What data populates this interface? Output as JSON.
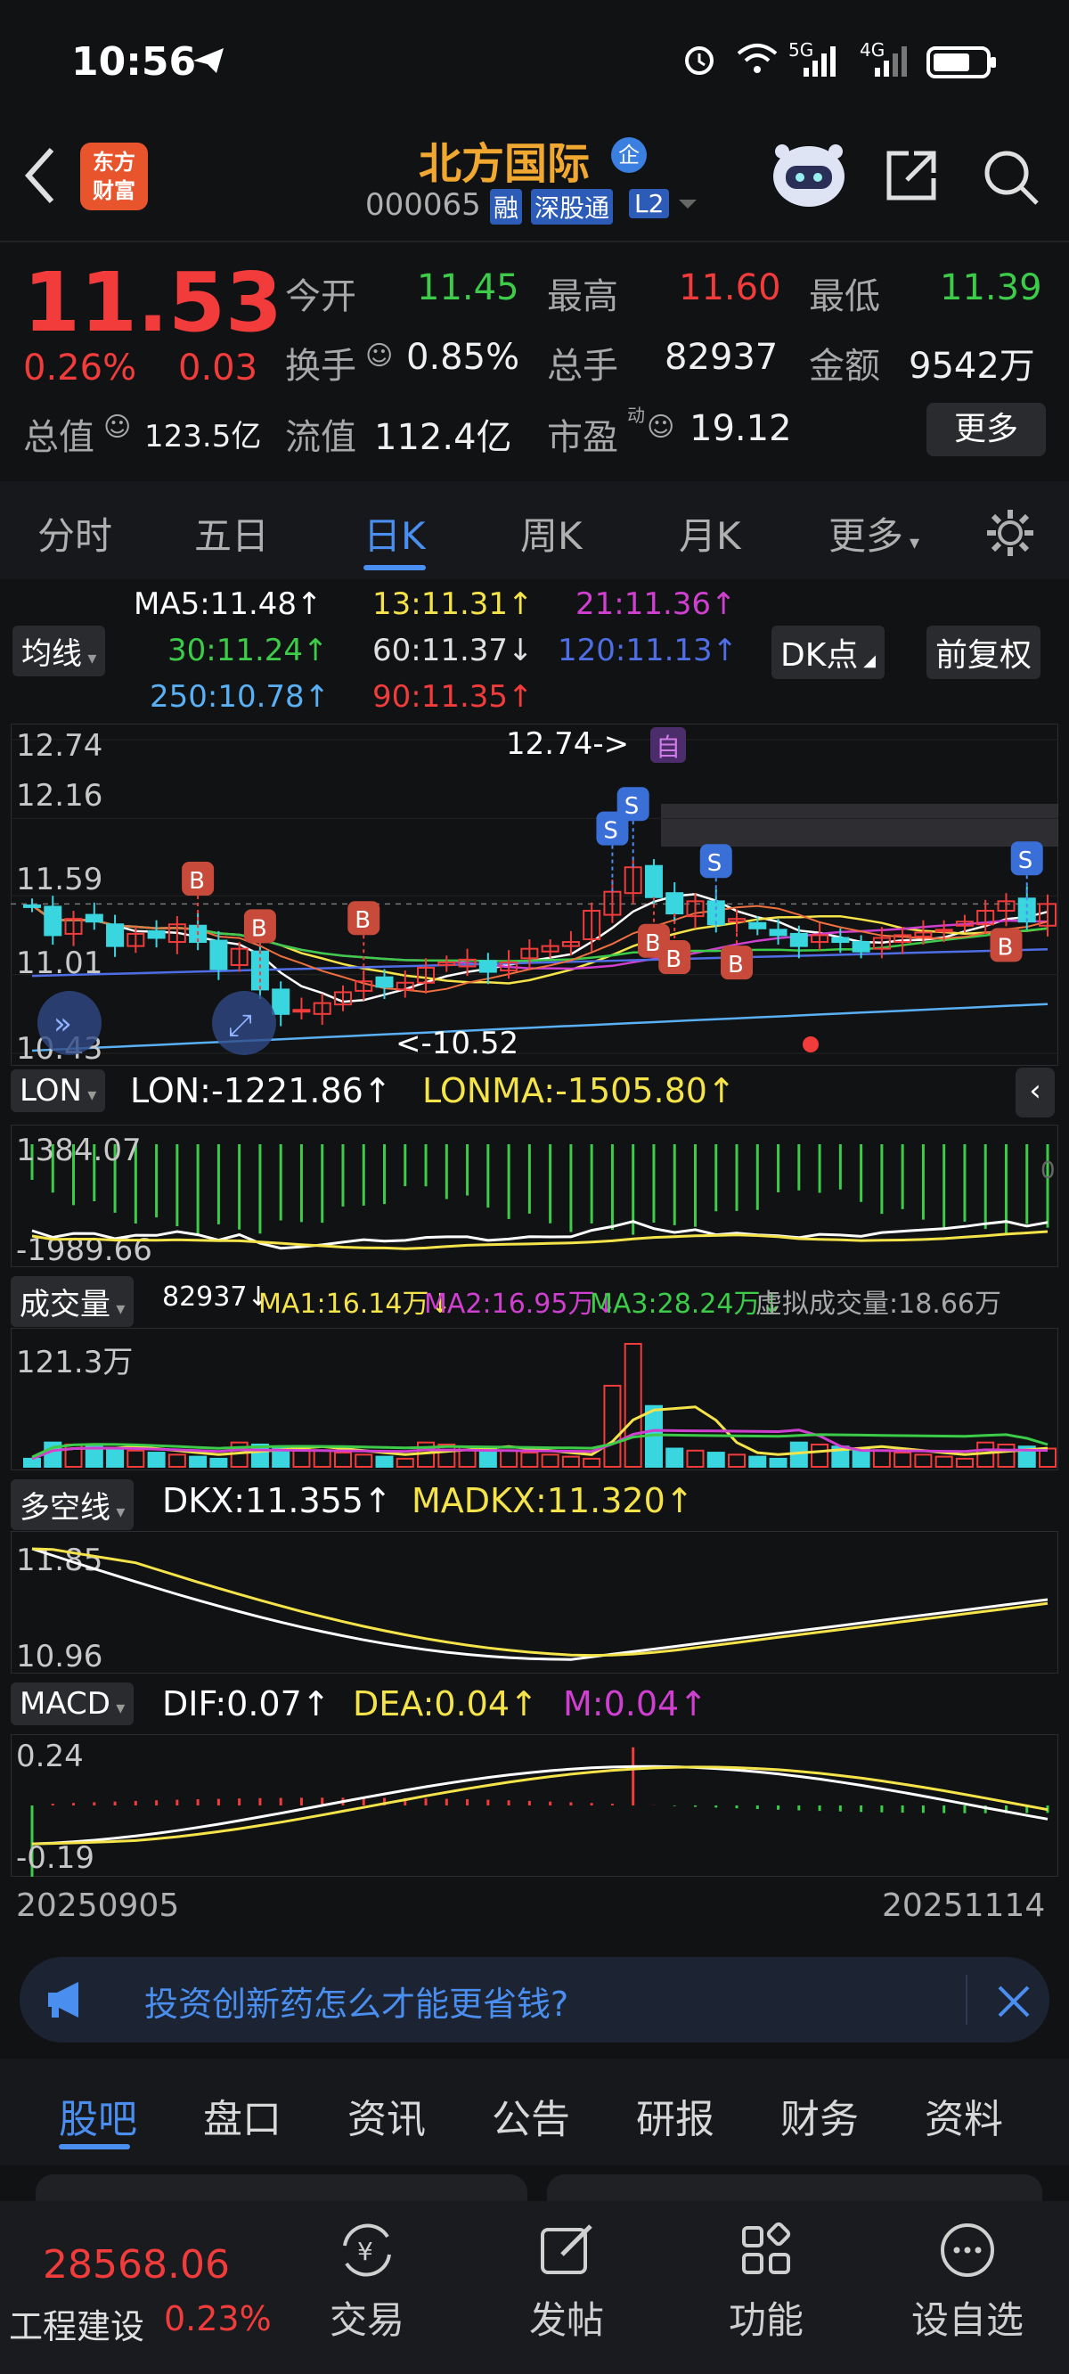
{
  "status": {
    "time": "10:56",
    "signal1": "5G",
    "signal2": "4G"
  },
  "header": {
    "logo_line1": "东方",
    "logo_line2": "财富",
    "title": "北方国际",
    "badge": "企",
    "code": "000065",
    "tags": [
      "融",
      "深股通",
      "L2"
    ]
  },
  "quote": {
    "price": "11.53",
    "pct": "0.26%",
    "change": "0.03",
    "open_label": "今开",
    "open": "11.45",
    "high_label": "最高",
    "high": "11.60",
    "low_label": "最低",
    "low": "11.39",
    "turnover_label": "换手",
    "turnover": "0.85%",
    "volume_label": "总手",
    "volume": "82937",
    "amount_label": "金额",
    "amount": "9542万",
    "mktcap_label": "总值",
    "mktcap": "123.5亿",
    "float_label": "流值",
    "float": "112.4亿",
    "pe_label": "市盈",
    "pe_sup": "动",
    "pe": "19.12",
    "more": "更多"
  },
  "tabs": [
    "分时",
    "五日",
    "日K",
    "周K",
    "月K",
    "更多"
  ],
  "ma": {
    "selector": "均线",
    "ma5": "MA5:11.48↑",
    "ma13": "13:11.31↑",
    "ma21": "21:11.36↑",
    "ma30": "30:11.24↑",
    "ma60": "60:11.37↓",
    "ma120": "120:11.13↑",
    "ma250": "250:10.78↑",
    "ma90": "90:11.35↑",
    "dk": "DK点",
    "adj": "前复权"
  },
  "kline": {
    "y_labels": [
      "12.74",
      "12.16",
      "11.59",
      "11.01",
      "10.43"
    ],
    "high_note": "12.74->",
    "low_note": "<-10.52",
    "self_tag": "自",
    "buy": "B",
    "sell": "S"
  },
  "lon": {
    "name": "LON",
    "value": "LON:-1221.86↑",
    "ma": "LONMA:-1505.80↑",
    "top": "1384.07",
    "bottom": "-1989.66",
    "zero": "0"
  },
  "vol": {
    "name": "成交量",
    "value": "82937↓",
    "ma1": "MA1:16.14万↓",
    "ma2": "MA2:16.95万↓",
    "ma3": "MA3:28.24万↓",
    "virtual": "虚拟成交量:18.66万",
    "top": "121.3万"
  },
  "dkx": {
    "name": "多空线",
    "value": "DKX:11.355↑",
    "ma": "MADKX:11.320↑",
    "top": "11.85",
    "bottom": "10.96"
  },
  "macd": {
    "name": "MACD",
    "dif": "DIF:0.07↑",
    "dea": "DEA:0.04↑",
    "m": "M:0.04↑",
    "top": "0.24",
    "bottom": "-0.19"
  },
  "dates": {
    "start": "20250905",
    "end": "20251114"
  },
  "banner": {
    "text": "投资创新药怎么才能更省钱?"
  },
  "bottom_tabs": [
    "股吧",
    "盘口",
    "资讯",
    "公告",
    "研报",
    "财务",
    "资料"
  ],
  "footer": {
    "index_value": "28568.06",
    "index_name": "工程建设",
    "index_pct": "0.23%",
    "trade": "交易",
    "trade_icon_char": "¥",
    "post": "发帖",
    "func": "功能",
    "watch": "设自选"
  },
  "colors": {
    "up": "#f23c3c",
    "down": "#3dcc4a",
    "accent": "#4a8ff0",
    "title": "#f0a830"
  },
  "chart_data": {
    "type": "candlestick",
    "xrange": [
      "20250905",
      "20251114"
    ],
    "yrange": [
      10.43,
      12.74
    ],
    "closes": [
      11.52,
      11.3,
      11.42,
      11.4,
      11.22,
      11.31,
      11.28,
      11.38,
      11.25,
      11.05,
      11.2,
      10.9,
      10.72,
      10.75,
      10.8,
      10.88,
      10.96,
      10.92,
      10.95,
      11.06,
      11.1,
      11.12,
      11.03,
      11.1,
      11.2,
      11.22,
      11.25,
      11.48,
      11.62,
      11.8,
      11.58,
      11.46,
      11.55,
      11.38,
      11.42,
      11.35,
      11.3,
      11.22,
      11.3,
      11.25,
      11.18,
      11.28,
      11.3,
      11.32,
      11.34,
      11.4,
      11.48,
      11.55,
      11.4,
      11.53
    ]
  }
}
